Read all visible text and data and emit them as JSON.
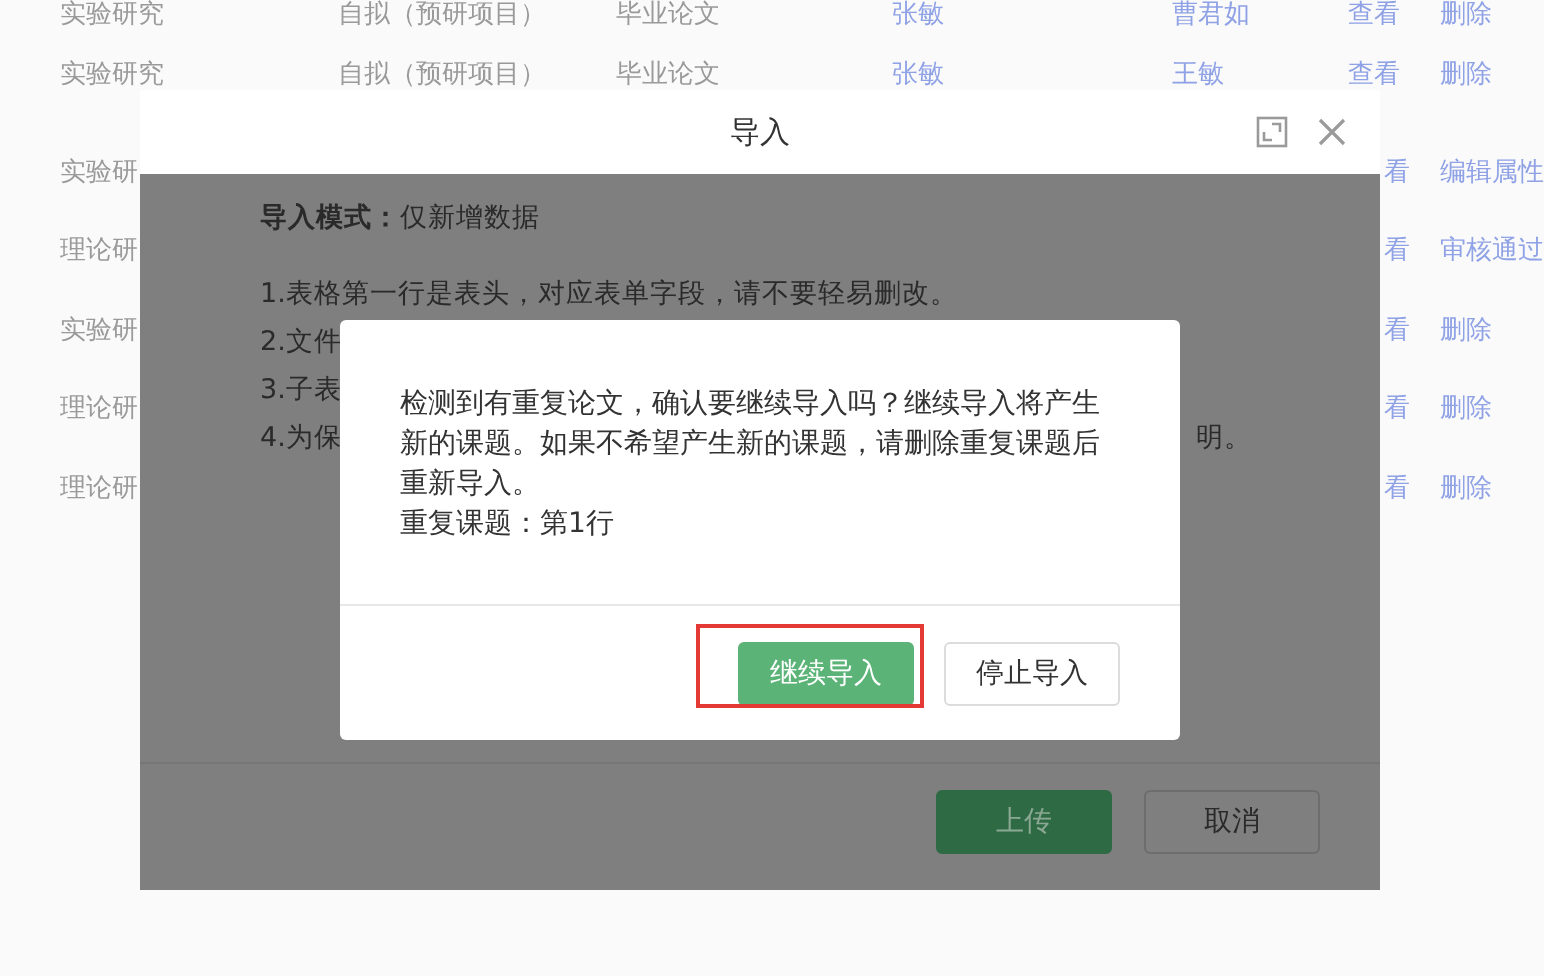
{
  "table": {
    "rows": [
      {
        "cells": [
          {
            "text": "实验研究",
            "kind": "text"
          },
          {
            "text": "自拟（预研项目）",
            "kind": "text"
          },
          {
            "text": "毕业论文",
            "kind": "text"
          },
          {
            "text": "张敏",
            "kind": "link"
          },
          {
            "text": "曹君如",
            "kind": "link"
          },
          {
            "text": "查看",
            "kind": "link"
          },
          {
            "text": "删除",
            "kind": "link"
          }
        ]
      },
      {
        "cells": [
          {
            "text": "实验研究",
            "kind": "text"
          },
          {
            "text": "自拟（预研项目）",
            "kind": "text"
          },
          {
            "text": "毕业论文",
            "kind": "text"
          },
          {
            "text": "张敏",
            "kind": "link"
          },
          {
            "text": "王敏",
            "kind": "link"
          },
          {
            "text": "查看",
            "kind": "link"
          },
          {
            "text": "删除",
            "kind": "link"
          }
        ]
      }
    ],
    "partial_rows": [
      {
        "left": "实验研",
        "right": [
          "看",
          "编辑属性"
        ]
      },
      {
        "left": "理论研",
        "right": [
          "看",
          "审核通过"
        ]
      },
      {
        "left": "实验研",
        "right": [
          "看",
          "删除"
        ]
      },
      {
        "left": "理论研",
        "right": [
          "看",
          "删除"
        ]
      },
      {
        "left": "理论研",
        "right": [
          "看",
          "删除"
        ]
      }
    ]
  },
  "import_dialog": {
    "title": "导入",
    "mode": "**导入模式：**仅新增数据",
    "notes": [
      {
        "left": "1.表格第一行是表头，对应表单字段，请不要轻易删改。"
      },
      {
        "left": "2.文件"
      },
      {
        "left": "3.子表"
      },
      {
        "left": "4.为保",
        "right": "明。"
      }
    ],
    "buttons": [
      {
        "label": "上传",
        "kind": "primary"
      },
      {
        "label": "取消",
        "kind": "default"
      }
    ]
  },
  "confirm_dialog": {
    "message": "检测到有重复论文，确认要继续导入吗？继续导入将产生新的课题。如果不希望产生新的课题，请删除重复课题后重新导入。",
    "detail": "重复课题：第1行",
    "buttons": [
      {
        "label": "继续导入",
        "kind": "primary",
        "highlighted": true
      },
      {
        "label": "停止导入",
        "kind": "default",
        "highlighted": false
      }
    ]
  }
}
